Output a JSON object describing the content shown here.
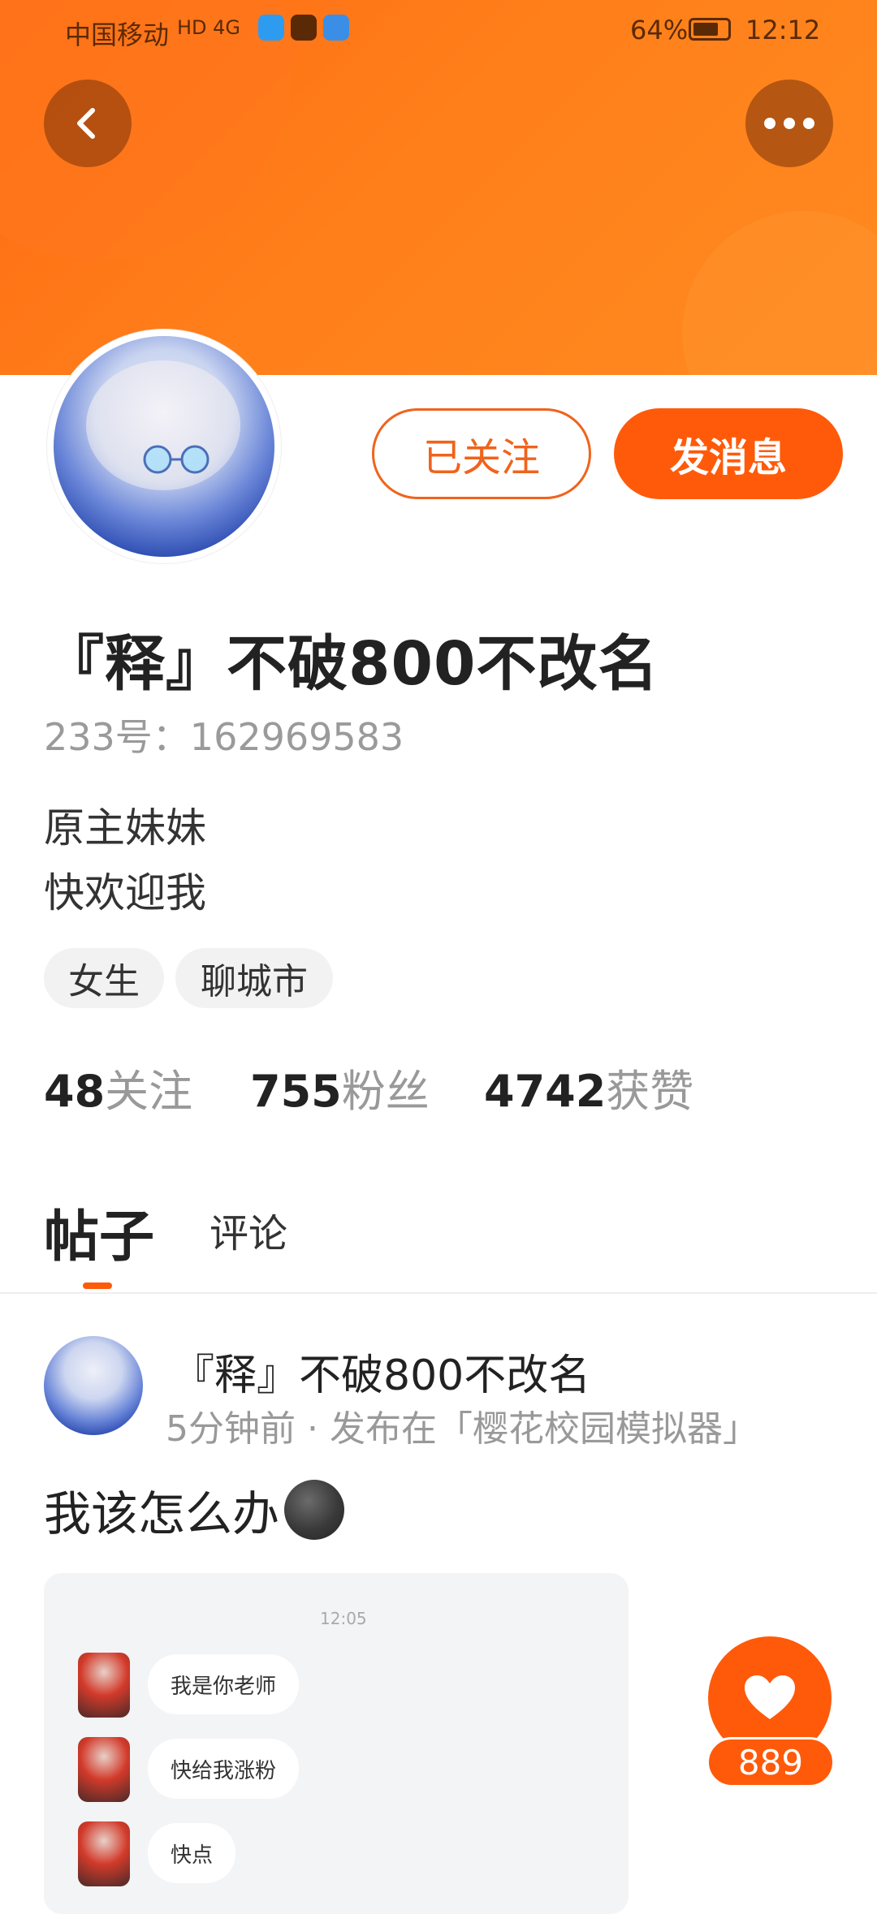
{
  "status_bar": {
    "carrier": "中国移动",
    "network": "HD 4G",
    "battery_percent": "64%",
    "time": "12:12"
  },
  "header": {
    "back_icon": "chevron-left-icon",
    "more_icon": "more-horizontal-icon"
  },
  "profile": {
    "follow_button": "已关注",
    "message_button": "发消息",
    "name": "『释』不破800不改名",
    "uid": "233号：162969583",
    "bio": [
      "原主妹妹",
      "快欢迎我"
    ],
    "tags": [
      "女生",
      "聊城市"
    ],
    "stats": [
      {
        "value": "48",
        "label": "关注"
      },
      {
        "value": "755",
        "label": "粉丝"
      },
      {
        "value": "4742",
        "label": "获赞"
      }
    ]
  },
  "tabs": {
    "posts": "帖子",
    "comments": "评论",
    "active": "posts"
  },
  "post": {
    "author": "『释』不破800不改名",
    "meta": "5分钟前 · 发布在「樱花校园模拟器」",
    "text": "我该怎么办",
    "emoji": "new-moon-face-emoji",
    "image": {
      "time": "12:05",
      "messages": [
        "我是你老师",
        "快给我涨粉",
        "快点"
      ]
    },
    "likes": "889"
  },
  "colors": {
    "accent": "#ff5a0a",
    "banner": "#ff7a18",
    "follow_outline": "#f0631c"
  }
}
